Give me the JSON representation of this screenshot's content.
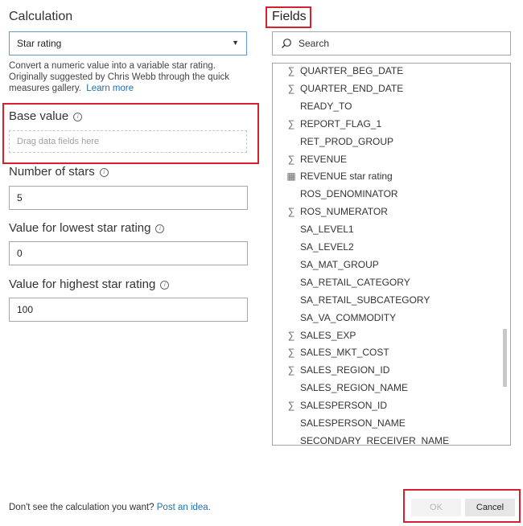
{
  "calculation": {
    "title": "Calculation",
    "dropdown_value": "Star rating",
    "description_line1": "Convert a numeric value into a variable star rating.",
    "description_line2": "Originally suggested by Chris Webb through the quick",
    "description_line3_prefix": "measures gallery.",
    "learn_more": "Learn more"
  },
  "base_value": {
    "label": "Base value",
    "placeholder": "Drag data fields here"
  },
  "number_of_stars": {
    "label": "Number of stars",
    "value": "5"
  },
  "lowest_rating": {
    "label": "Value for lowest star rating",
    "value": "0"
  },
  "highest_rating": {
    "label": "Value for highest star rating",
    "value": "100"
  },
  "fields": {
    "title": "Fields",
    "search_placeholder": "Search",
    "items": [
      {
        "name": "QUARTER_BEG_DATE",
        "icon": "sigma-icon"
      },
      {
        "name": "QUARTER_END_DATE",
        "icon": "sigma-icon"
      },
      {
        "name": "READY_TO",
        "icon": ""
      },
      {
        "name": "REPORT_FLAG_1",
        "icon": "sigma-icon"
      },
      {
        "name": "RET_PROD_GROUP",
        "icon": ""
      },
      {
        "name": "REVENUE",
        "icon": "sigma-icon"
      },
      {
        "name": "REVENUE star rating",
        "icon": "calculator-icon"
      },
      {
        "name": "ROS_DENOMINATOR",
        "icon": ""
      },
      {
        "name": "ROS_NUMERATOR",
        "icon": "sigma-icon"
      },
      {
        "name": "SA_LEVEL1",
        "icon": ""
      },
      {
        "name": "SA_LEVEL2",
        "icon": ""
      },
      {
        "name": "SA_MAT_GROUP",
        "icon": ""
      },
      {
        "name": "SA_RETAIL_CATEGORY",
        "icon": ""
      },
      {
        "name": "SA_RETAIL_SUBCATEGORY",
        "icon": ""
      },
      {
        "name": "SA_VA_COMMODITY",
        "icon": ""
      },
      {
        "name": "SALES_EXP",
        "icon": "sigma-icon"
      },
      {
        "name": "SALES_MKT_COST",
        "icon": "sigma-icon"
      },
      {
        "name": "SALES_REGION_ID",
        "icon": "sigma-icon"
      },
      {
        "name": "SALES_REGION_NAME",
        "icon": ""
      },
      {
        "name": "SALESPERSON_ID",
        "icon": "sigma-icon"
      },
      {
        "name": "SALESPERSON_NAME",
        "icon": ""
      },
      {
        "name": "SECONDARY_RECEIVER_NAME",
        "icon": ""
      }
    ]
  },
  "footer": {
    "question": "Don't see the calculation you want?",
    "post_idea": "Post an idea.",
    "ok_label": "OK",
    "cancel_label": "Cancel"
  },
  "colors": {
    "highlight": "#d6202f",
    "link": "#1f6fb5"
  }
}
